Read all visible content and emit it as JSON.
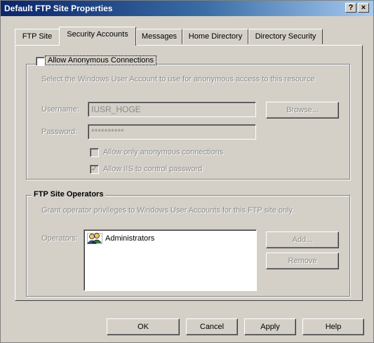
{
  "window": {
    "title": "Default FTP Site Properties",
    "help_button": "?",
    "close_button": "×"
  },
  "tabs": [
    {
      "label": "FTP Site"
    },
    {
      "label": "Security Accounts"
    },
    {
      "label": "Messages"
    },
    {
      "label": "Home Directory"
    },
    {
      "label": "Directory Security"
    }
  ],
  "anonymous": {
    "group_label": "Allow Anonymous Connections",
    "checked": false,
    "description": "Select the Windows User Account to use for anonymous access to this resource",
    "username_label": "Username:",
    "username_value": "IUSR_HOGE",
    "browse_button": "Browse...",
    "password_label": "Password:",
    "password_value": "**********",
    "only_anonymous_label": "Allow only anonymous connections",
    "only_anonymous_checked": false,
    "iis_control_label": "Allow IIS to control password",
    "iis_control_checked": true
  },
  "operators": {
    "group_label": "FTP Site Operators",
    "description": "Grant operator privileges to Windows User Accounts for this FTP site only.",
    "operators_label": "Operators:",
    "list": [
      {
        "name": "Administrators",
        "icon": "group-users-icon"
      }
    ],
    "add_button": "Add...",
    "remove_button": "Remove"
  },
  "footer": {
    "ok_button": "OK",
    "cancel_button": "Cancel",
    "apply_button": "Apply",
    "help_button": "Help"
  },
  "colors": {
    "title_gradient_start": "#0a246a",
    "title_gradient_end": "#a6caf0",
    "dialog_face": "#d4d0c8",
    "disabled_text": "#8a8a8a"
  }
}
